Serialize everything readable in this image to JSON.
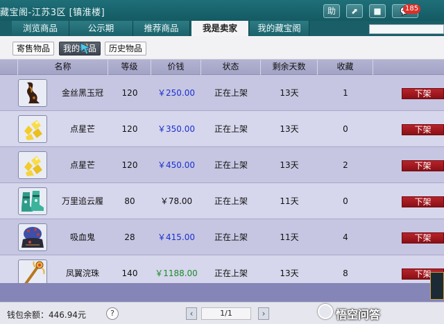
{
  "window": {
    "title": "藏宝阁-江苏3区 [镇淮楼]",
    "badge_count": "185",
    "buttons": [
      {
        "name": "help",
        "glyph": "助"
      },
      {
        "name": "share",
        "glyph": "⬈"
      },
      {
        "name": "stop",
        "glyph": "■"
      },
      {
        "name": "chat",
        "glyph": "💬"
      }
    ]
  },
  "tabs": [
    {
      "label": "浏览商品",
      "active": false
    },
    {
      "label": "公示期",
      "active": false
    },
    {
      "label": "推荐商品",
      "active": false
    },
    {
      "label": "我是卖家",
      "active": true
    },
    {
      "label": "我的藏宝阁",
      "active": false
    }
  ],
  "sub_tabs": [
    {
      "label": "寄售物品",
      "active": false
    },
    {
      "label": "我的物品",
      "active": true
    },
    {
      "label": "历史物品",
      "active": false
    }
  ],
  "table": {
    "headers": [
      "名称",
      "等级",
      "价钱",
      "状态",
      "剩余天数",
      "收藏"
    ],
    "rows": [
      {
        "name": "金丝黑玉冠",
        "level": "120",
        "price": "￥250.00",
        "price_color": "blue",
        "status": "正在上架",
        "days": "13天",
        "fav": "1",
        "action": "下架",
        "icon": "crown-icon"
      },
      {
        "name": "点星芒",
        "level": "120",
        "price": "￥350.00",
        "price_color": "blue",
        "status": "正在上架",
        "days": "13天",
        "fav": "0",
        "action": "下架",
        "icon": "gold-ore-icon"
      },
      {
        "name": "点星芒",
        "level": "120",
        "price": "￥450.00",
        "price_color": "blue",
        "status": "正在上架",
        "days": "13天",
        "fav": "2",
        "action": "下架",
        "icon": "gold-ore-icon"
      },
      {
        "name": "万里追云履",
        "level": "80",
        "price": "￥78.00",
        "price_color": "black",
        "status": "正在上架",
        "days": "11天",
        "fav": "0",
        "action": "下架",
        "icon": "boots-icon"
      },
      {
        "name": "吸血鬼",
        "level": "28",
        "price": "￥415.00",
        "price_color": "blue",
        "status": "正在上架",
        "days": "11天",
        "fav": "4",
        "action": "下架",
        "icon": "vampire-icon"
      },
      {
        "name": "凤翼浣珠",
        "level": "140",
        "price": "￥1188.00",
        "price_color": "green",
        "status": "正在上架",
        "days": "13天",
        "fav": "8",
        "action": "下架",
        "icon": "staff-icon"
      }
    ]
  },
  "footer": {
    "wallet": "钱包余额：446.94元",
    "help": "?",
    "page": "1/1",
    "prev": "‹",
    "next": "›"
  },
  "watermark": "悟空问答"
}
